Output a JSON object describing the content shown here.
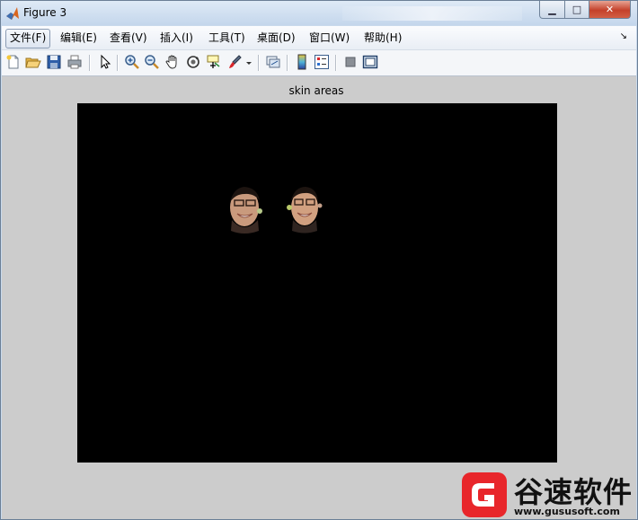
{
  "window": {
    "title": "Figure 3",
    "min_glyph": "▁",
    "max_glyph": "□",
    "close_glyph": "✕"
  },
  "menu": {
    "items": [
      {
        "label": "文件(F)",
        "active": true
      },
      {
        "label": "编辑(E)"
      },
      {
        "label": "查看(V)"
      },
      {
        "label": "插入(I)"
      },
      {
        "label": "工具(T)"
      },
      {
        "label": "桌面(D)"
      },
      {
        "label": "窗口(W)"
      },
      {
        "label": "帮助(H)"
      }
    ],
    "overflow_glyph": "↘"
  },
  "toolbar": {
    "icons": [
      "new-figure-icon",
      "open-file-icon",
      "save-icon",
      "print-icon",
      "edit-plot-arrow-icon",
      "zoom-in-icon",
      "zoom-out-icon",
      "pan-hand-icon",
      "rotate-3d-icon",
      "data-cursor-icon",
      "brush-icon",
      "brush-dropdown-icon",
      "link-plot-icon",
      "colorbar-icon",
      "legend-icon",
      "hide-plot-tools-icon",
      "show-plot-tools-icon"
    ]
  },
  "plot": {
    "title": "skin areas",
    "background": "#000000",
    "figure_bg": "#cccccc"
  },
  "watermark": {
    "name": "谷速软件",
    "url": "www.gususoft.com",
    "logo_color": "#e8262b"
  }
}
